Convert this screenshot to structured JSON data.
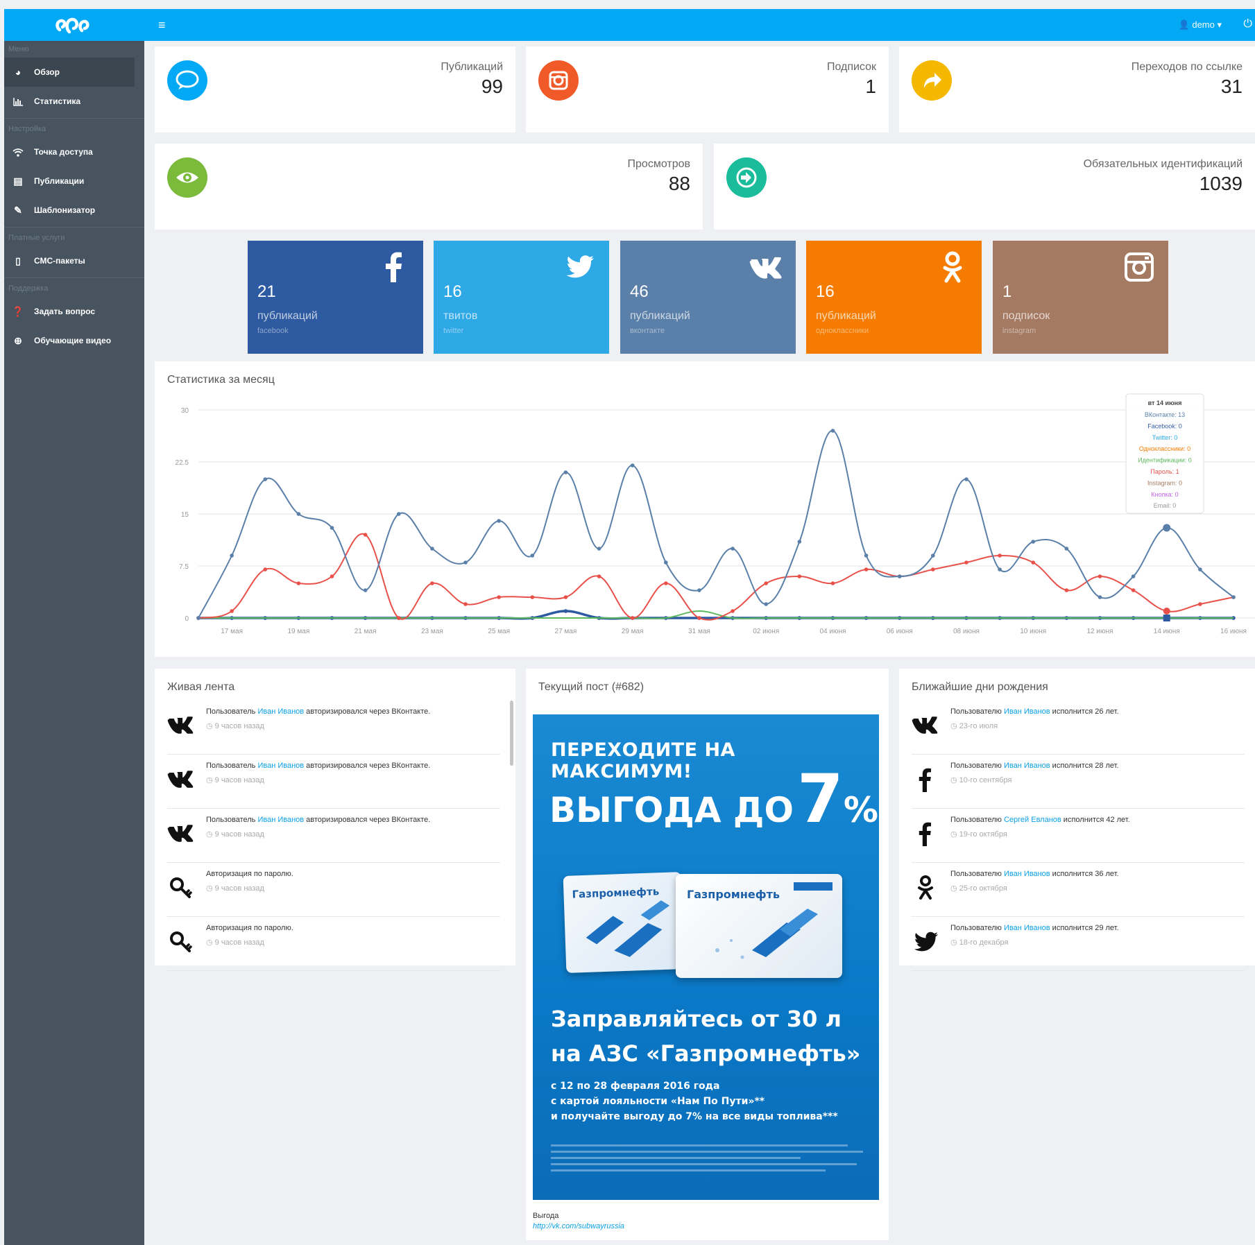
{
  "header": {
    "user_label": "demo ▾"
  },
  "sidebar": {
    "sections": [
      "Меню",
      "Настройка",
      "Платные услуги",
      "Поддержка"
    ],
    "items": [
      {
        "label": "Обзор"
      },
      {
        "label": "Статистика"
      },
      {
        "label": "Точка доступа"
      },
      {
        "label": "Публикации"
      },
      {
        "label": "Шаблонизатор"
      },
      {
        "label": "СМС-пакеты"
      },
      {
        "label": "Задать вопрос"
      },
      {
        "label": "Обучающие видео"
      }
    ]
  },
  "stats": [
    {
      "label": "Публикаций",
      "value": "99",
      "color": "#03a9f4",
      "icon": "chat-bubble-icon"
    },
    {
      "label": "Подписок",
      "value": "1",
      "color": "#f05a28",
      "icon": "instagram-icon"
    },
    {
      "label": "Переходов по ссылке",
      "value": "31",
      "color": "#f5b800",
      "icon": "share-arrow-icon"
    },
    {
      "label": "Просмотров",
      "value": "88",
      "color": "#7cba3c",
      "icon": "eye-icon"
    },
    {
      "label": "Обязательных идентификаций",
      "value": "1039",
      "color": "#1abc9c",
      "icon": "sign-in-icon"
    }
  ],
  "tiles": [
    {
      "number": "21",
      "word": "публикаций",
      "network": "facebook",
      "color": "#2d5aa0",
      "icon": "facebook-icon"
    },
    {
      "number": "16",
      "word": "твитов",
      "network": "twitter",
      "color": "#2fa8e6",
      "icon": "twitter-icon"
    },
    {
      "number": "46",
      "word": "публикаций",
      "network": "вконтакте",
      "color": "#5a7fa8",
      "icon": "vk-icon"
    },
    {
      "number": "16",
      "word": "публикаций",
      "network": "одноклассники",
      "color": "#f57c00",
      "icon": "odnoklassniki-icon"
    },
    {
      "number": "1",
      "word": "подписок",
      "network": "instagram",
      "color": "#a57a62",
      "icon": "instagram-icon"
    }
  ],
  "chart_data": {
    "type": "line",
    "title": "Статистика за месяц",
    "ylim": [
      0,
      30
    ],
    "yticks": [
      "0",
      "7.5",
      "15",
      "22.5",
      "30"
    ],
    "x_labels": [
      "17 мая",
      "19 мая",
      "21 мая",
      "23 мая",
      "25 мая",
      "27 мая",
      "29 мая",
      "31 мая",
      "02 июня",
      "04 июня",
      "06 июня",
      "08 июня",
      "10 июня",
      "12 июня",
      "14 июня",
      "16 июня"
    ],
    "series": [
      {
        "name": "ВКонтакте",
        "color": "#5a7fa8",
        "values": [
          0,
          9,
          20,
          15,
          13,
          4,
          15,
          10,
          8,
          14,
          9,
          21,
          10,
          22,
          8,
          4,
          10,
          2,
          11,
          27,
          9,
          6,
          9,
          20,
          7,
          11,
          10,
          3,
          6,
          13,
          7,
          3
        ]
      },
      {
        "name": "Пароль",
        "color": "#e8504a",
        "values": [
          0,
          1,
          7,
          5,
          6,
          12,
          0,
          5,
          2,
          3,
          3,
          3,
          6,
          0,
          5,
          0,
          1,
          5,
          6,
          5,
          7,
          6,
          7,
          8,
          9,
          8,
          4,
          6,
          4,
          1,
          2,
          3
        ]
      },
      {
        "name": "Twitter",
        "color": "#2d5aa0",
        "values": [
          0,
          0,
          0,
          0,
          0,
          0,
          0,
          0,
          0,
          0,
          0,
          1,
          0,
          0,
          0,
          0,
          0,
          0,
          0,
          0,
          0,
          0,
          0,
          0,
          0,
          0,
          0,
          0,
          0,
          0,
          0,
          0
        ]
      },
      {
        "name": "Идентификации",
        "color": "#5cb85c",
        "values": [
          0,
          0,
          0,
          0,
          0,
          0,
          0,
          0,
          0,
          0,
          0,
          0,
          0,
          0,
          0,
          1,
          0,
          0,
          0,
          0,
          0,
          0,
          0,
          0,
          0,
          0,
          0,
          0,
          0,
          0,
          0,
          0
        ]
      }
    ],
    "tooltip": {
      "title": "вт 14 июня",
      "lines": [
        {
          "text": "ВКонтакте: 13",
          "color": "#5a7fa8"
        },
        {
          "text": "Facebook: 0",
          "color": "#2d5aa0"
        },
        {
          "text": "Twitter: 0",
          "color": "#29a8e0"
        },
        {
          "text": "Одноклассники: 0",
          "color": "#f57c00"
        },
        {
          "text": "Идентификации: 0",
          "color": "#5cb85c"
        },
        {
          "text": "Пароль: 1",
          "color": "#e8504a"
        },
        {
          "text": "Instagram: 0",
          "color": "#a57a62"
        },
        {
          "text": "Кнопка: 0",
          "color": "#c060e0"
        },
        {
          "text": "Email: 0",
          "color": "#999999"
        }
      ]
    }
  },
  "live_feed": {
    "title": "Живая лента",
    "items": [
      {
        "icon": "vk-icon",
        "prefix": "Пользователь ",
        "user": "Иван Иванов",
        "suffix": " авторизировался через ВКонтакте.",
        "when": "◷ 9 часов назад"
      },
      {
        "icon": "vk-icon",
        "prefix": "Пользователь ",
        "user": "Иван Иванов",
        "suffix": " авторизировался через ВКонтакте.",
        "when": "◷ 9 часов назад"
      },
      {
        "icon": "vk-icon",
        "prefix": "Пользователь ",
        "user": "Иван Иванов",
        "suffix": " авторизировался через ВКонтакте.",
        "when": "◷ 9 часов назад"
      },
      {
        "icon": "key-icon",
        "prefix": "Авторизация по паролю.",
        "user": "",
        "suffix": "",
        "when": "◷ 9 часов назад"
      },
      {
        "icon": "key-icon",
        "prefix": "Авторизация по паролю.",
        "user": "",
        "suffix": "",
        "when": "◷ 9 часов назад"
      }
    ]
  },
  "current_post": {
    "title": "Текущий пост (#682)",
    "banner": {
      "headline": "ПЕРЕХОДИТЕ НА МАКСИМУМ!",
      "benefit": "ВЫГОДА ДО",
      "percent": "7",
      "percent_sign": "%",
      "asterisk": "*",
      "card_brand": "Газпромнефть",
      "slogan_1": "Заправляйтесь от 30 л",
      "slogan_2": "на АЗС «Газпромнефть»",
      "detail_1": "с 12 по 28 февраля 2016 года",
      "detail_2": "с картой лояльности «Нам По Пути»**",
      "detail_3": "и получайте выгоду до 7% на все виды топлива***"
    },
    "caption": "Выгода",
    "link": "http://vk.com/subwayrussia"
  },
  "birthdays": {
    "title": "Ближайшие дни рождения",
    "items": [
      {
        "icon": "vk-icon",
        "prefix": "Пользователю ",
        "user": "Иван Иванов",
        "suffix": " исполнится 26 лет.",
        "when": "◷ 23-го июля"
      },
      {
        "icon": "facebook-icon",
        "prefix": "Пользователю ",
        "user": "Иван Иванов",
        "suffix": " исполнится 28 лет.",
        "when": "◷ 10-го сентября"
      },
      {
        "icon": "facebook-icon",
        "prefix": "Пользователю ",
        "user": "Сергей Евланов",
        "suffix": " исполнится 42 лет.",
        "when": "◷ 19-го октября"
      },
      {
        "icon": "odnoklassniki-icon",
        "prefix": "Пользователю ",
        "user": "Иван Иванов",
        "suffix": " исполнится 36 лет.",
        "when": "◷ 25-го октября"
      },
      {
        "icon": "twitter-icon",
        "prefix": "Пользователю ",
        "user": "Иван Иванов",
        "suffix": " исполнится 29 лет.",
        "when": "◷ 18-го декабря"
      }
    ]
  }
}
